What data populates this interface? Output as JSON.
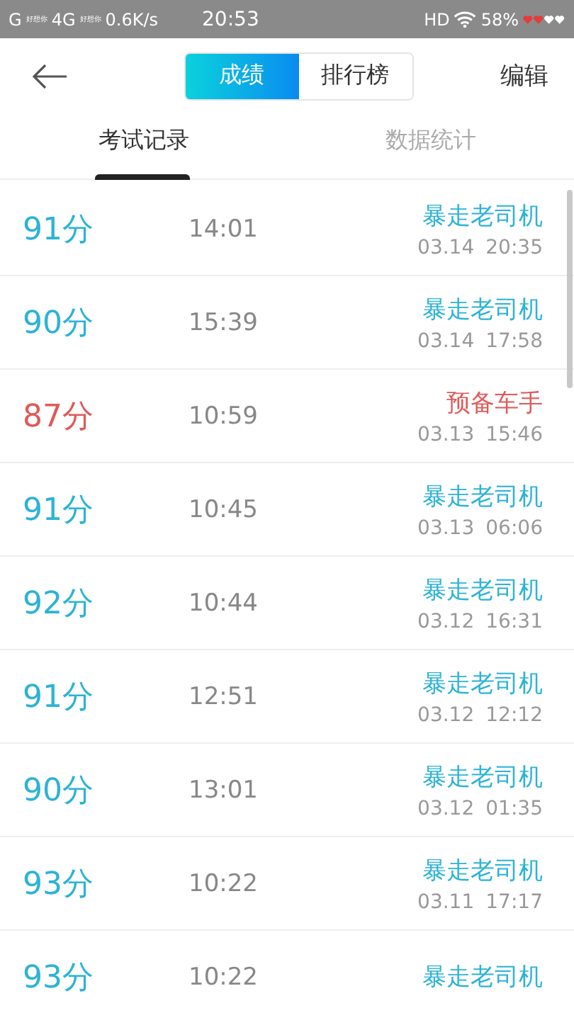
{
  "status_bar": {
    "carrier_1": "G",
    "carrier_1_name": "好想你",
    "carrier_2": "4G",
    "carrier_2_name": "好想你",
    "speed": "0.6K/s",
    "time": "20:53",
    "hd": "HD",
    "battery": "58%"
  },
  "header": {
    "segments": [
      {
        "label": "成绩",
        "selected": true
      },
      {
        "label": "排行榜",
        "selected": false
      }
    ],
    "edit": "编辑"
  },
  "tabs": [
    {
      "label": "考试记录",
      "selected": true
    },
    {
      "label": "数据统计",
      "selected": false
    }
  ],
  "records": [
    {
      "score": "91分",
      "duration": "14:01",
      "rank": "暴走老司机",
      "kind": "pass",
      "date": "03.14",
      "time": "20:35"
    },
    {
      "score": "90分",
      "duration": "15:39",
      "rank": "暴走老司机",
      "kind": "pass",
      "date": "03.14",
      "time": "17:58"
    },
    {
      "score": "87分",
      "duration": "10:59",
      "rank": "预备车手",
      "kind": "fail",
      "date": "03.13",
      "time": "15:46"
    },
    {
      "score": "91分",
      "duration": "10:45",
      "rank": "暴走老司机",
      "kind": "pass",
      "date": "03.13",
      "time": "06:06"
    },
    {
      "score": "92分",
      "duration": "10:44",
      "rank": "暴走老司机",
      "kind": "pass",
      "date": "03.12",
      "time": "16:31"
    },
    {
      "score": "91分",
      "duration": "12:51",
      "rank": "暴走老司机",
      "kind": "pass",
      "date": "03.12",
      "time": "12:12"
    },
    {
      "score": "90分",
      "duration": "13:01",
      "rank": "暴走老司机",
      "kind": "pass",
      "date": "03.12",
      "time": "01:35"
    },
    {
      "score": "93分",
      "duration": "10:22",
      "rank": "暴走老司机",
      "kind": "pass",
      "date": "03.11",
      "time": "17:17"
    },
    {
      "score": "93分",
      "duration": "10:22",
      "rank": "暴走老司机",
      "kind": "pass"
    }
  ]
}
